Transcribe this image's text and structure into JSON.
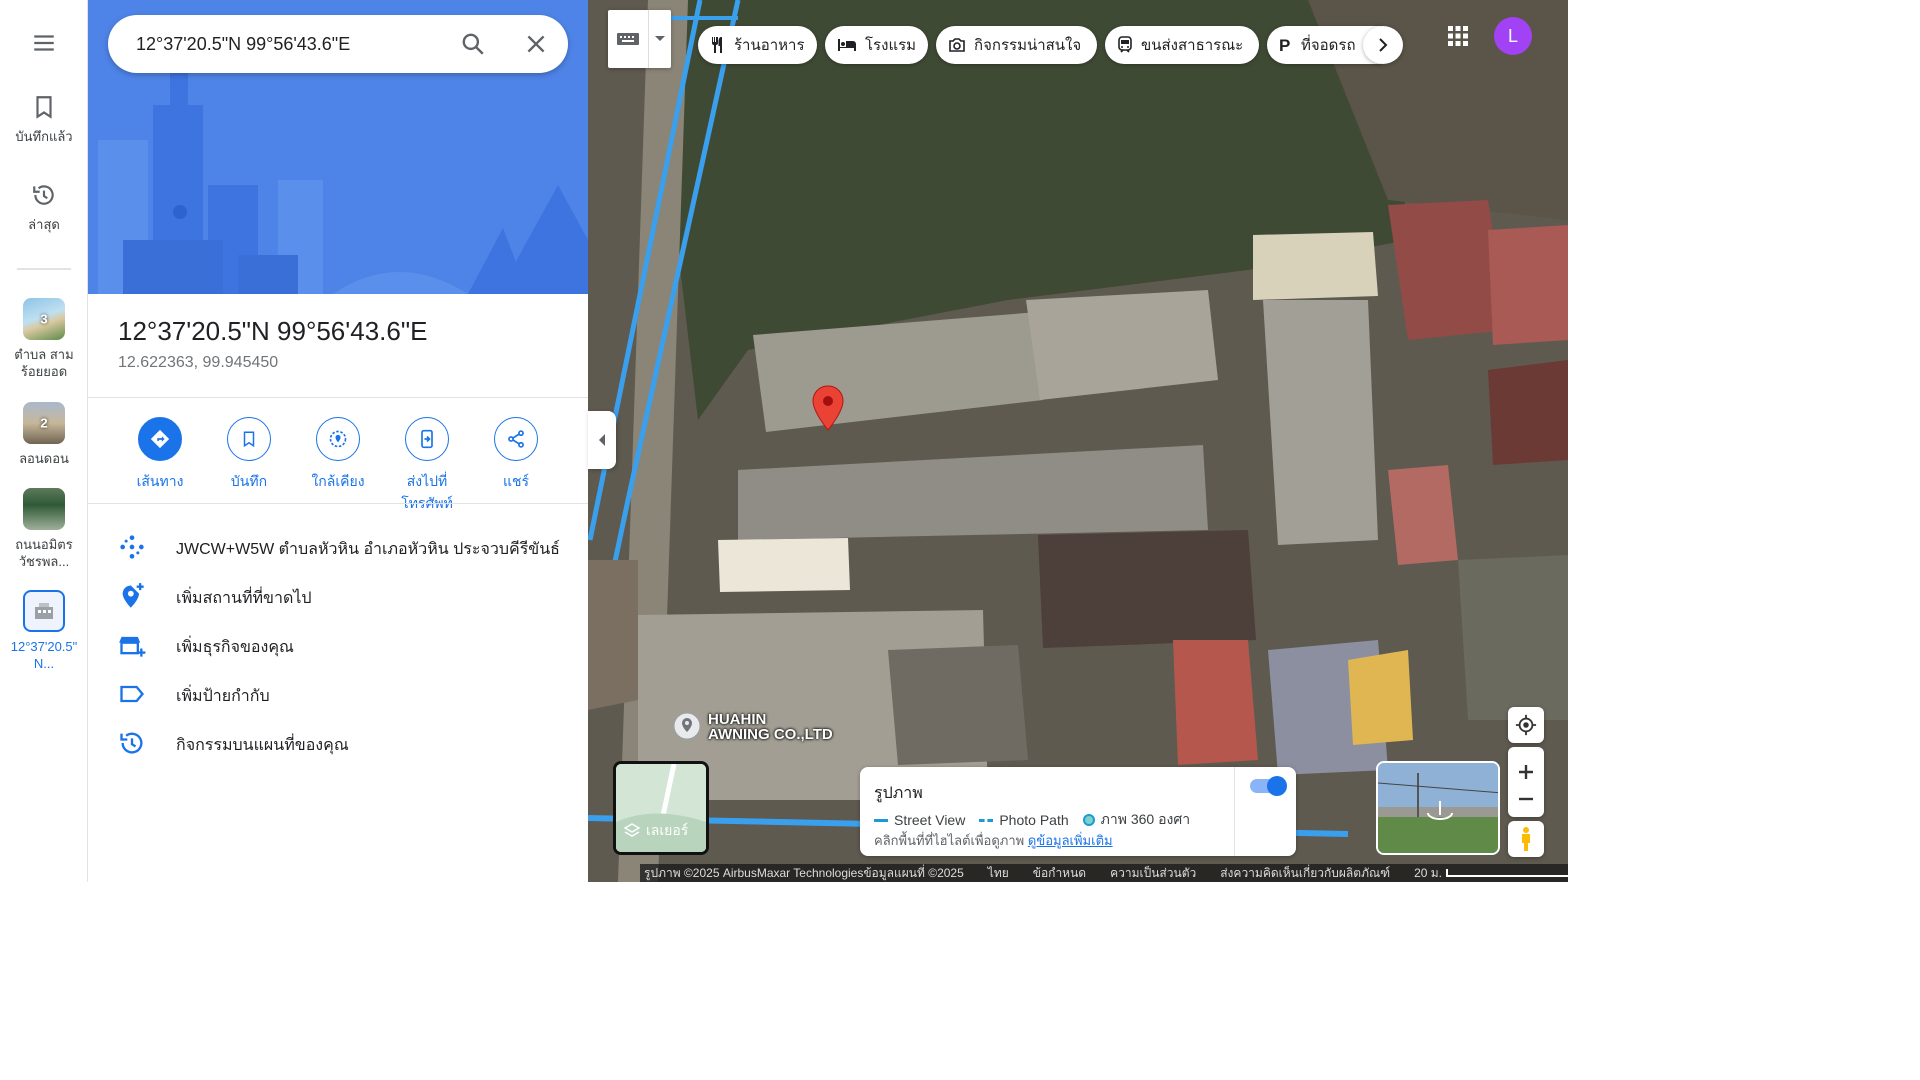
{
  "search": {
    "value": "12°37'20.5\"N 99°56'43.6\"E"
  },
  "rail": {
    "saved_label": "บันทึกแล้ว",
    "recent_label": "ล่าสุด",
    "history": [
      {
        "label_line1": "ตำบล สาม",
        "label_line2": "ร้อยยอด",
        "count": "3"
      },
      {
        "label_line1": "ลอนดอน",
        "label_line2": "",
        "count": "2"
      },
      {
        "label_line1": "ถนนอมิตร",
        "label_line2": "วัชรพล...",
        "count": ""
      },
      {
        "label_line1": "12°37'20.5\"",
        "label_line2": "N...",
        "count": ""
      }
    ]
  },
  "place": {
    "title": "12°37'20.5\"N 99°56'43.6\"E",
    "decimal": "12.622363, 99.945450"
  },
  "actions": [
    {
      "label": "เส้นทาง"
    },
    {
      "label": "บันทึก"
    },
    {
      "label": "ใกล้เคียง"
    },
    {
      "label": "ส่งไปที่โทรศัพท์"
    },
    {
      "label": "แชร์"
    }
  ],
  "info_rows": [
    {
      "text": "JWCW+W5W ตำบลหัวหิน อำเภอหัวหิน ประจวบคีรีขันธ์",
      "icon": "plus-code-icon"
    },
    {
      "text": "เพิ่มสถานที่ที่ขาดไป",
      "icon": "add-location-icon"
    },
    {
      "text": "เพิ่มธุรกิจของคุณ",
      "icon": "add-business-icon"
    },
    {
      "text": "เพิ่มป้ายกำกับ",
      "icon": "label-icon"
    },
    {
      "text": "กิจกรรมบนแผนที่ของคุณ",
      "icon": "history-icon"
    }
  ],
  "chips": [
    {
      "label": "ร้านอาหาร",
      "icon": "restaurant-icon"
    },
    {
      "label": "โรงแรม",
      "icon": "hotel-icon"
    },
    {
      "label": "กิจกรรมน่าสนใจ",
      "icon": "camera-icon"
    },
    {
      "label": "ขนส่งสาธารณะ",
      "icon": "transit-icon"
    },
    {
      "label": "ที่จอดรถ",
      "icon": "parking-icon"
    }
  ],
  "avatar_letter": "L",
  "poi": {
    "line1": "HUAHIN",
    "line2": "AWNING CO.,LTD"
  },
  "layers_label": "เลเยอร์",
  "photo_card": {
    "title": "รูปภาพ",
    "legend_street": "Street View",
    "legend_path": "Photo Path",
    "legend_360": "ภาพ 360 องศา",
    "hint": "คลิกพื้นที่ที่ไฮไลต์เพื่อดูภาพ",
    "more_link": "ดูข้อมูลเพิ่มเติม"
  },
  "footer": {
    "copyright": "รูปภาพ ©2025 AirbusMaxar Technologiesข้อมูลแผนที่ ©2025",
    "lang": "ไทย",
    "terms": "ข้อกำหนด",
    "privacy": "ความเป็นส่วนตัว",
    "feedback": "ส่งความคิดเห็นเกี่ยวกับผลิตภัณฑ์",
    "scale": "20 ม."
  },
  "colors": {
    "accent": "#1a73e8",
    "avatar": "#a142f4",
    "pin": "#ea4335",
    "hero": "#4e84e8"
  }
}
